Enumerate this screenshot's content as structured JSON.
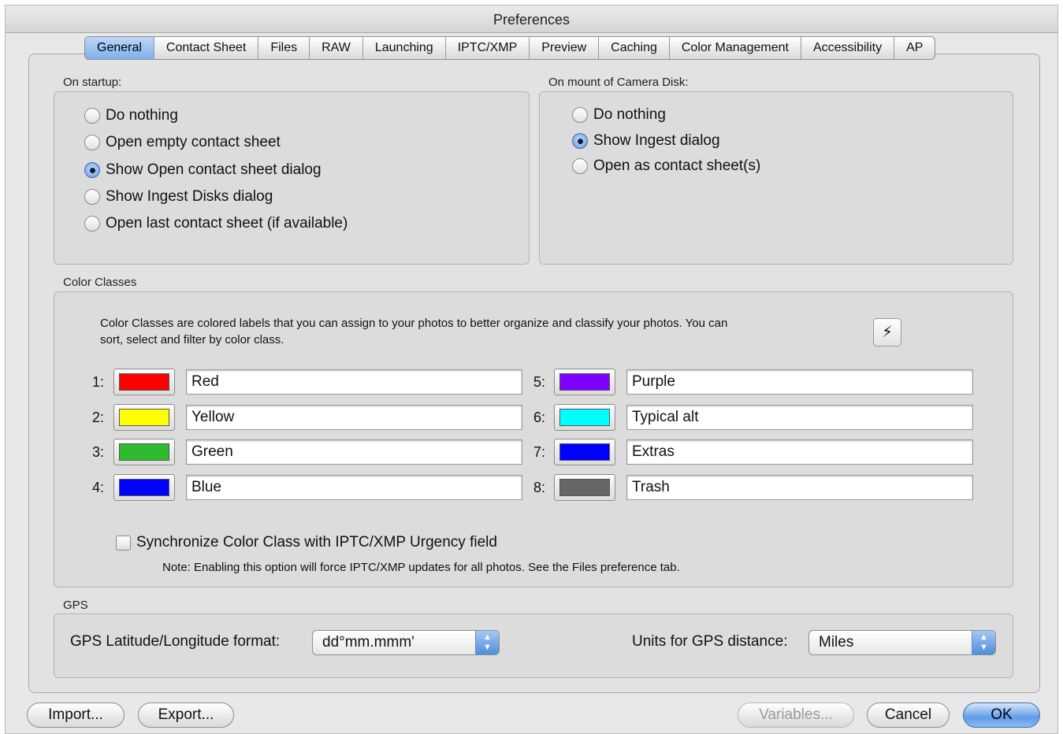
{
  "window": {
    "title": "Preferences"
  },
  "tabs": [
    "General",
    "Contact Sheet",
    "Files",
    "RAW",
    "Launching",
    "IPTC/XMP",
    "Preview",
    "Caching",
    "Color Management",
    "Accessibility",
    "AP"
  ],
  "active_tab": "General",
  "startup": {
    "label": "On startup:",
    "options": [
      "Do nothing",
      "Open empty contact sheet",
      "Show Open contact sheet dialog",
      "Show Ingest Disks dialog",
      "Open last contact sheet (if available)"
    ],
    "selected": "Show Open contact sheet dialog"
  },
  "mount": {
    "label": "On mount of Camera Disk:",
    "options": [
      "Do nothing",
      "Show Ingest dialog",
      "Open as contact sheet(s)"
    ],
    "selected": "Show Ingest dialog"
  },
  "color_classes": {
    "label": "Color Classes",
    "description_line1": "Color Classes are colored labels that you can assign to your photos to better organize and classify your photos.  You can",
    "description_line2": "sort, select and filter by color class.",
    "action_glyph": "⚡",
    "items": [
      {
        "num": "1:",
        "name": "Red",
        "color": "#ff0000"
      },
      {
        "num": "2:",
        "name": "Yellow",
        "color": "#ffff00"
      },
      {
        "num": "3:",
        "name": "Green",
        "color": "#2dbb2d"
      },
      {
        "num": "4:",
        "name": "Blue",
        "color": "#0000ff"
      },
      {
        "num": "5:",
        "name": "Purple",
        "color": "#8000ff"
      },
      {
        "num": "6:",
        "name": "Typical alt",
        "color": "#00ffff"
      },
      {
        "num": "7:",
        "name": "Extras",
        "color": "#0000ff"
      },
      {
        "num": "8:",
        "name": "Trash",
        "color": "#666666"
      }
    ],
    "sync_label": "Synchronize Color Class with IPTC/XMP Urgency field",
    "sync_checked": false,
    "note": "Note: Enabling this option will force IPTC/XMP updates for all photos. See the Files preference tab."
  },
  "gps": {
    "label": "GPS",
    "format_label": "GPS Latitude/Longitude format:",
    "format_value": "dd°mm.mmm'",
    "units_label": "Units for GPS distance:",
    "units_value": "Miles"
  },
  "buttons": {
    "import": "Import...",
    "export": "Export...",
    "variables": "Variables...",
    "cancel": "Cancel",
    "ok": "OK"
  }
}
